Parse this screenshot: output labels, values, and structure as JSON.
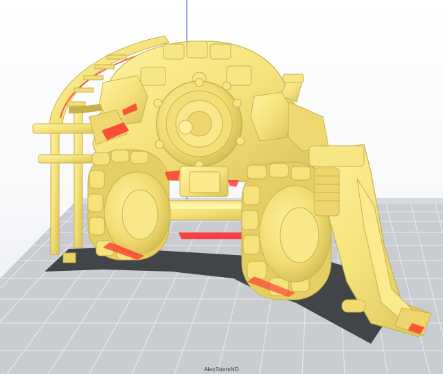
{
  "viewport": {
    "background_top": "#ffffff",
    "background_bottom": "#e6e8ee",
    "build_plate_color": "#c9ccd1",
    "grid_line_color": "#e6e8ec",
    "axis_line_color": "#3a56ff",
    "model_color": "#f5e27a",
    "model_shadow_color": "#c9b54e",
    "overhang_color": "#ff2a2a",
    "model_footprint_color": "#3b3d40"
  },
  "watermark": {
    "text": "AlexStormND"
  }
}
